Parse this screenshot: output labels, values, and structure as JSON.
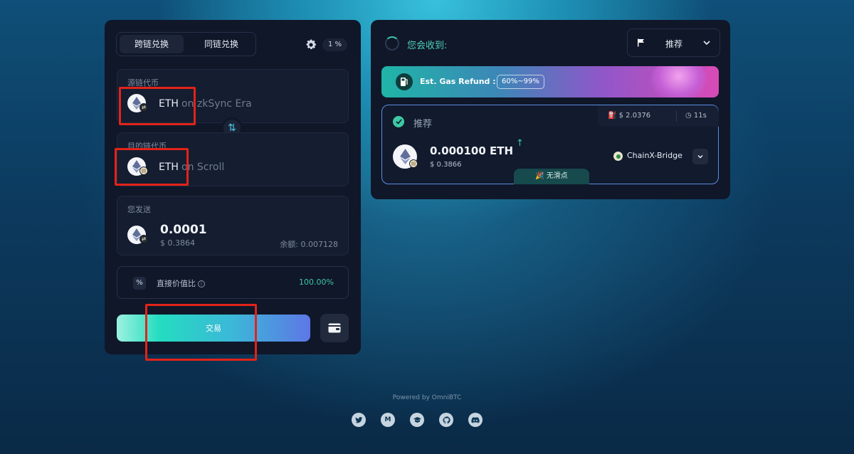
{
  "swap_panel": {
    "tabs": [
      {
        "label": "跨链兑换",
        "active": true
      },
      {
        "label": "同链兑换",
        "active": false
      }
    ],
    "slippage": "1 %",
    "source": {
      "label": "源链代币",
      "token": "ETH",
      "chain_text": "on zkSync Era",
      "icon": "eth-icon"
    },
    "destination": {
      "label": "目的链代币",
      "token": "ETH",
      "chain_text": "on Scroll",
      "icon": "eth-icon"
    },
    "send": {
      "label": "您发送",
      "amount": "0.0001",
      "usd": "$ 0.3864",
      "balance": "余额: 0.007128"
    },
    "ratio": {
      "label": "直接价值比",
      "value": "100.00%"
    },
    "trade_button": "交易"
  },
  "quote_panel": {
    "receive_label": "您会收到:",
    "sort_label": "推荐",
    "gas_refund": {
      "text": "Est. Gas Refund :",
      "range": "60%~99%"
    },
    "route": {
      "label": "推荐",
      "gas_cost": "$ 2.0376",
      "time": "11s",
      "amount": "0.000100 ETH",
      "usd": "$ 0.3866",
      "bridge": "ChainX-Bridge",
      "tag": "无滑点"
    }
  },
  "footer": {
    "powered_by": "Powered by OmniBTC",
    "social_icons": [
      "twitter-icon",
      "medium-icon",
      "docs-icon",
      "github-icon",
      "discord-icon"
    ]
  },
  "colors": {
    "accent_green": "#3cc9a4",
    "annotation_red": "#e2231a",
    "panel_bg": "#0f1729"
  }
}
